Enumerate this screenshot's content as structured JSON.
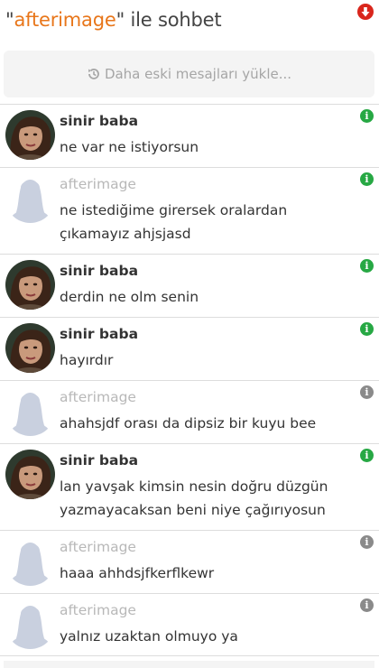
{
  "header": {
    "quote_open": "\"",
    "partner": "afterimage",
    "quote_close": "\"",
    "suffix": " ile sohbet",
    "scroll_down_icon": "arrow-down-circle-icon"
  },
  "load_older": {
    "icon": "history-icon",
    "label": "Daha eski mesajları yükle..."
  },
  "messages": [
    {
      "user": "sinir baba",
      "text": "ne var ne istiyorsun",
      "avatar": "photo",
      "info": "green"
    },
    {
      "user": "afterimage",
      "text": "ne istediğime girersek oralardan çıkamayız ahjsjasd",
      "avatar": "placeholder",
      "info": "green"
    },
    {
      "user": "sinir baba",
      "text": "derdin ne olm senin",
      "avatar": "photo",
      "info": "green"
    },
    {
      "user": "sinir baba",
      "text": "hayırdır",
      "avatar": "photo",
      "info": "green"
    },
    {
      "user": "afterimage",
      "text": "ahahsjdf orası da dipsiz bir kuyu bee",
      "avatar": "placeholder",
      "info": "gray"
    },
    {
      "user": "sinir baba",
      "text": "lan yavşak kimsin nesin doğru düzgün yazmayacaksan beni niye çağırıyosun",
      "avatar": "photo",
      "info": "green"
    },
    {
      "user": "afterimage",
      "text": "haaa ahhdsjfkerflkewr",
      "avatar": "placeholder",
      "info": "gray"
    },
    {
      "user": "afterimage",
      "text": "yalnız uzaktan olmuyo ya",
      "avatar": "placeholder",
      "info": "gray"
    }
  ],
  "colors": {
    "accent": "#e8761a",
    "read": "#27a844",
    "unread": "#8a8a8a",
    "scroll_button": "#d9261c"
  },
  "info_glyph": "i"
}
